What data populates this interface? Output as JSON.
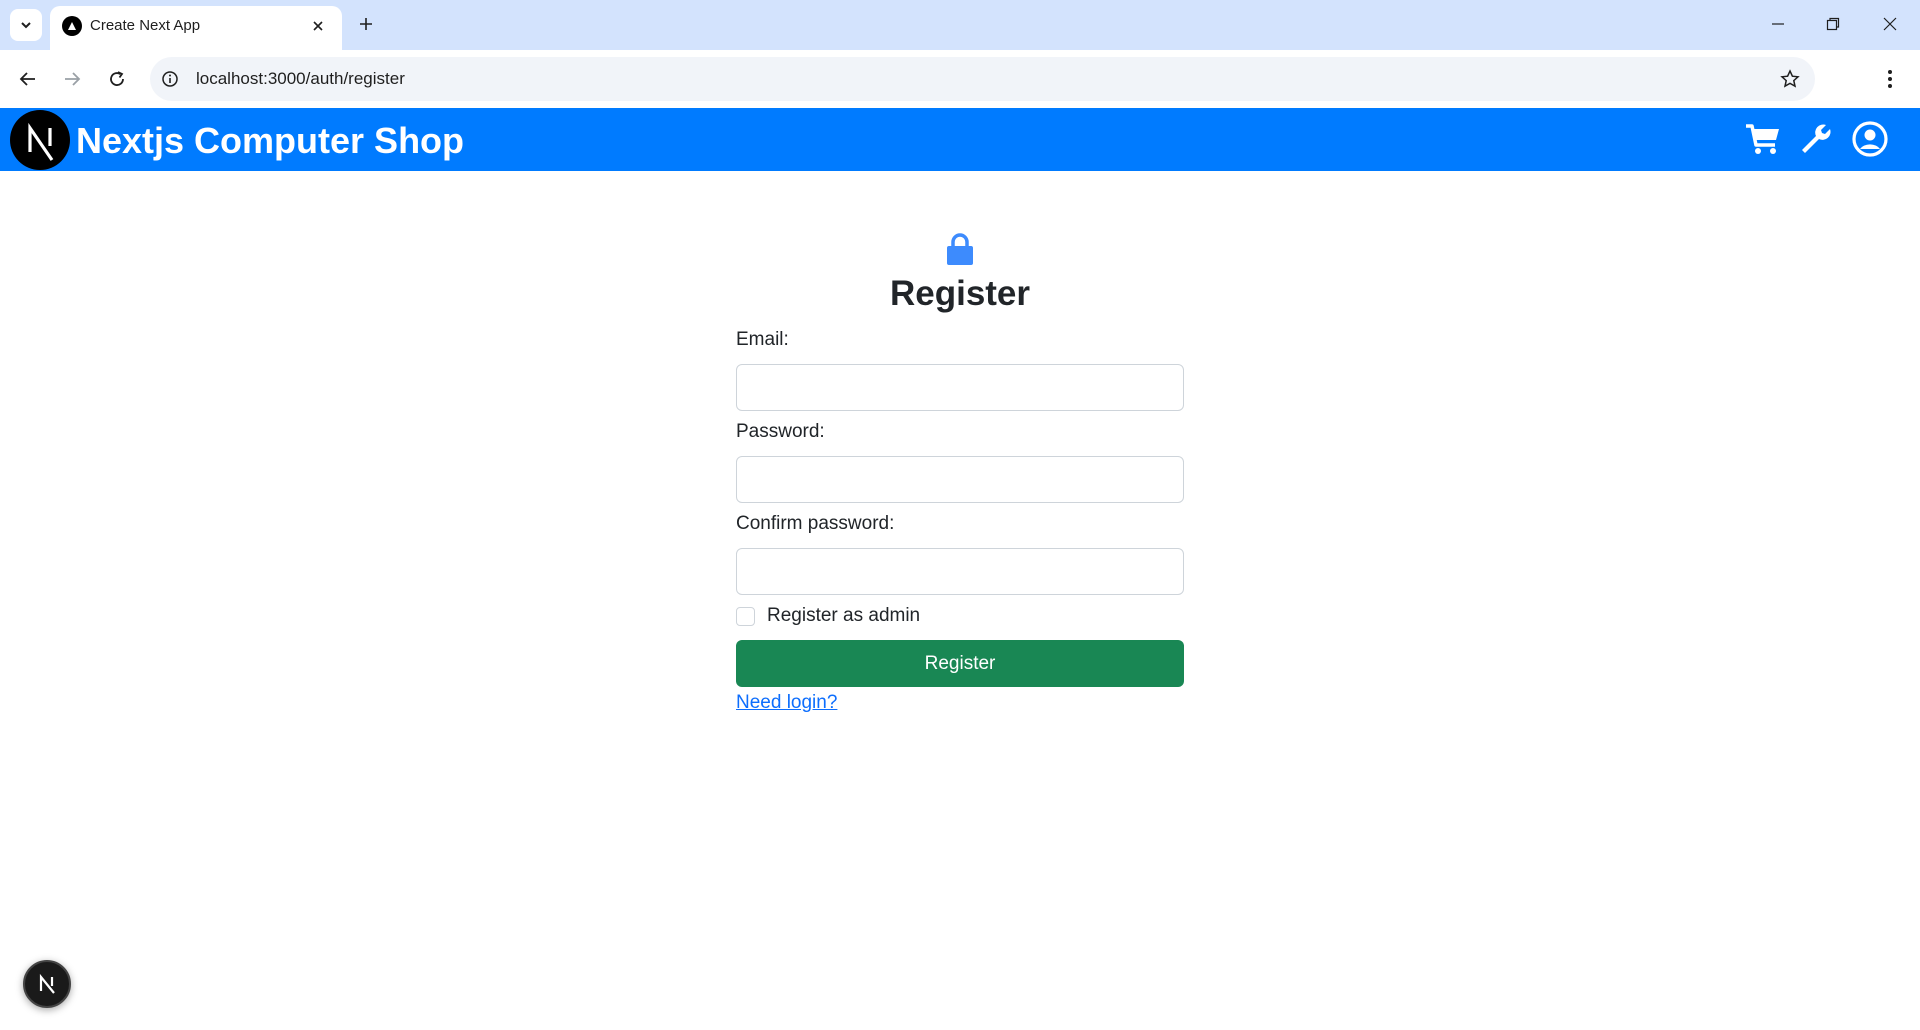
{
  "browser": {
    "tab_title": "Create Next App",
    "url": "localhost:3000/auth/register"
  },
  "navbar": {
    "brand_name": "Nextjs Computer Shop",
    "logo_letter": "N"
  },
  "form": {
    "title": "Register",
    "email_label": "Email:",
    "email_value": "",
    "password_label": "Password:",
    "password_value": "",
    "confirm_label": "Confirm password:",
    "confirm_value": "",
    "admin_checkbox_label": "Register as admin",
    "admin_checked": false,
    "submit_label": "Register",
    "login_link": "Need login?"
  },
  "dev_indicator": {
    "letter": "N"
  },
  "colors": {
    "navbar": "#007bff",
    "submit": "#198754",
    "link": "#0d6efd",
    "lock": "#3d8bfd"
  }
}
